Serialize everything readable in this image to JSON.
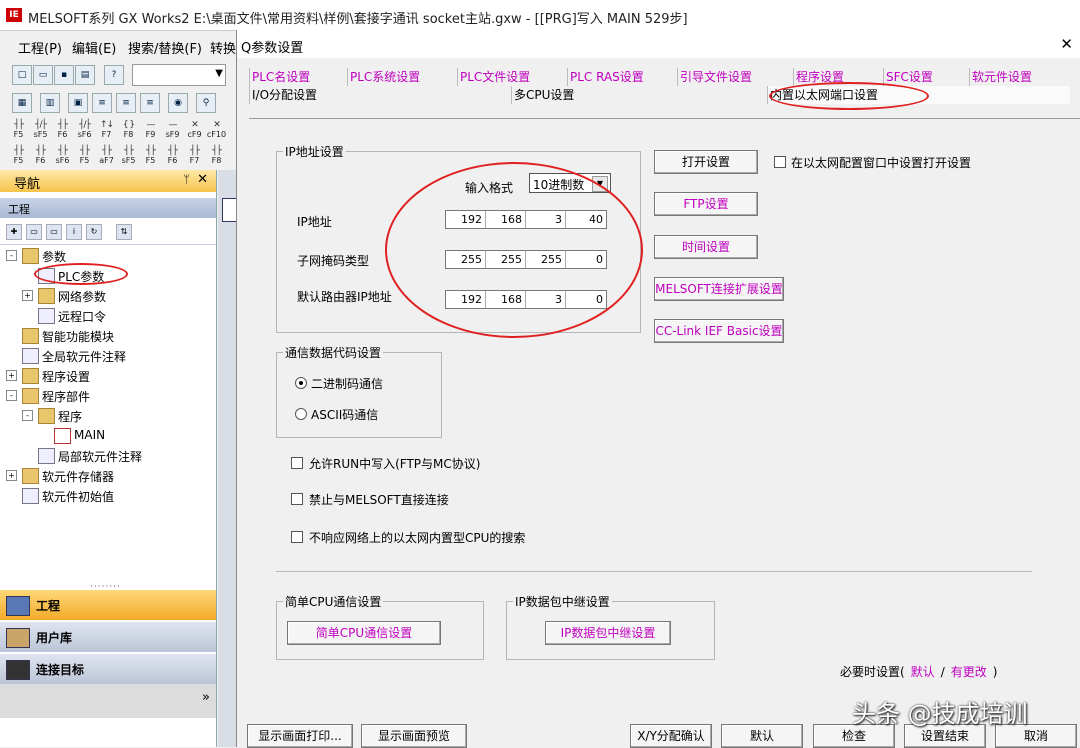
{
  "app": {
    "title": "MELSOFT系列 GX Works2 E:\\桌面文件\\常用资料\\样例\\套接字通讯 socket主站.gxw - [[PRG]写入 MAIN 529步]",
    "logo_text": "IE"
  },
  "menu": {
    "project": "工程(P)",
    "edit": "编辑(E)",
    "search": "搜索/替换(F)",
    "convert": "转换"
  },
  "toolbar": {
    "fkeys_row1": [
      {
        "sym": "┤├",
        "k": "F5"
      },
      {
        "sym": "┤/├",
        "k": "sF5"
      },
      {
        "sym": "┤├",
        "k": "F6"
      },
      {
        "sym": "┤/├",
        "k": "sF6"
      },
      {
        "sym": "↑↓",
        "k": "F7"
      },
      {
        "sym": "{ }",
        "k": "F8"
      },
      {
        "sym": "—",
        "k": "F9"
      },
      {
        "sym": "—",
        "k": "sF9"
      },
      {
        "sym": "✕",
        "k": "cF9"
      },
      {
        "sym": "✕",
        "k": "cF10"
      }
    ],
    "fkeys_row2": [
      {
        "sym": "┤├",
        "k": "F5"
      },
      {
        "sym": "┤├",
        "k": "F6"
      },
      {
        "sym": "┤├",
        "k": "sF6"
      },
      {
        "sym": "┤├",
        "k": "F5"
      },
      {
        "sym": "┤├",
        "k": "aF7"
      },
      {
        "sym": "┤├",
        "k": "sF5"
      },
      {
        "sym": "┤├",
        "k": "F5"
      },
      {
        "sym": "┤├",
        "k": "F6"
      },
      {
        "sym": "┤├",
        "k": "F7"
      },
      {
        "sym": "┤├",
        "k": "F8"
      }
    ]
  },
  "nav": {
    "title": "导航",
    "pin": "ᛘ",
    "close": "✕",
    "section": "工程",
    "tree": [
      {
        "label": "参数",
        "level": 0,
        "exp": "-",
        "icon": "folder"
      },
      {
        "label": "PLC参数",
        "level": 1,
        "exp": "",
        "icon": "doc"
      },
      {
        "label": "网络参数",
        "level": 1,
        "exp": "+",
        "icon": "folder"
      },
      {
        "label": "远程口令",
        "level": 1,
        "exp": "",
        "icon": "doc"
      },
      {
        "label": "智能功能模块",
        "level": 0,
        "exp": "",
        "icon": "folder"
      },
      {
        "label": "全局软元件注释",
        "level": 0,
        "exp": "",
        "icon": "doc"
      },
      {
        "label": "程序设置",
        "level": 0,
        "exp": "+",
        "icon": "folder"
      },
      {
        "label": "程序部件",
        "level": 0,
        "exp": "-",
        "icon": "folder"
      },
      {
        "label": "程序",
        "level": 1,
        "exp": "-",
        "icon": "folder"
      },
      {
        "label": "MAIN",
        "level": 2,
        "exp": "",
        "icon": "main"
      },
      {
        "label": "局部软元件注释",
        "level": 1,
        "exp": "",
        "icon": "doc"
      },
      {
        "label": "软元件存储器",
        "level": 0,
        "exp": "+",
        "icon": "folder"
      },
      {
        "label": "软元件初始值",
        "level": 0,
        "exp": "",
        "icon": "doc"
      }
    ],
    "tabs": [
      "工程",
      "用户库",
      "连接目标"
    ],
    "more": "»"
  },
  "dialog": {
    "title": "Q参数设置",
    "close": "✕",
    "tabs_row1": [
      "PLC名设置",
      "PLC系统设置",
      "PLC文件设置",
      "PLC RAS设置",
      "引导文件设置",
      "程序设置",
      "SFC设置",
      "软元件设置"
    ],
    "tabs_row2": [
      "I/O分配设置",
      "多CPU设置",
      "内置以太网端口设置"
    ],
    "ip_group": {
      "caption": "IP地址设置",
      "input_format_label": "输入格式",
      "input_format_value": "10进制数",
      "ip_label": "IP地址",
      "ip": [
        "192",
        "168",
        "3",
        "40"
      ],
      "mask_label": "子网掩码类型",
      "mask": [
        "255",
        "255",
        "255",
        "0"
      ],
      "gw_label": "默认路由器IP地址",
      "gw": [
        "192",
        "168",
        "3",
        "0"
      ]
    },
    "buttons_right": {
      "open": "打开设置",
      "ftp": "FTP设置",
      "time": "时间设置",
      "melsoft": "MELSOFT连接扩展设置",
      "cclink": "CC-Link IEF Basic设置"
    },
    "open_in_window": "在以太网配置窗口中设置打开设置",
    "comm_group": {
      "caption": "通信数据代码设置",
      "binary": "二进制码通信",
      "ascii": "ASCII码通信"
    },
    "options": [
      "允许RUN中写入(FTP与MC协议)",
      "禁止与MELSOFT直接连接",
      "不响应网络上的以太网内置型CPU的搜索"
    ],
    "simple_cpu": {
      "caption": "简单CPU通信设置",
      "button": "简单CPU通信设置"
    },
    "ip_relay": {
      "caption": "IP数据包中继设置",
      "button": "IP数据包中继设置"
    },
    "required": {
      "prefix": "必要时设置(",
      "default": "默认",
      "slash": "/",
      "changed": "有更改",
      "suffix": ")"
    },
    "footer": [
      "显示画面打印...",
      "显示画面预览",
      "X/Y分配确认",
      "默认",
      "检查",
      "设置结束",
      "取消"
    ]
  },
  "watermark": "头条 @技成培训"
}
